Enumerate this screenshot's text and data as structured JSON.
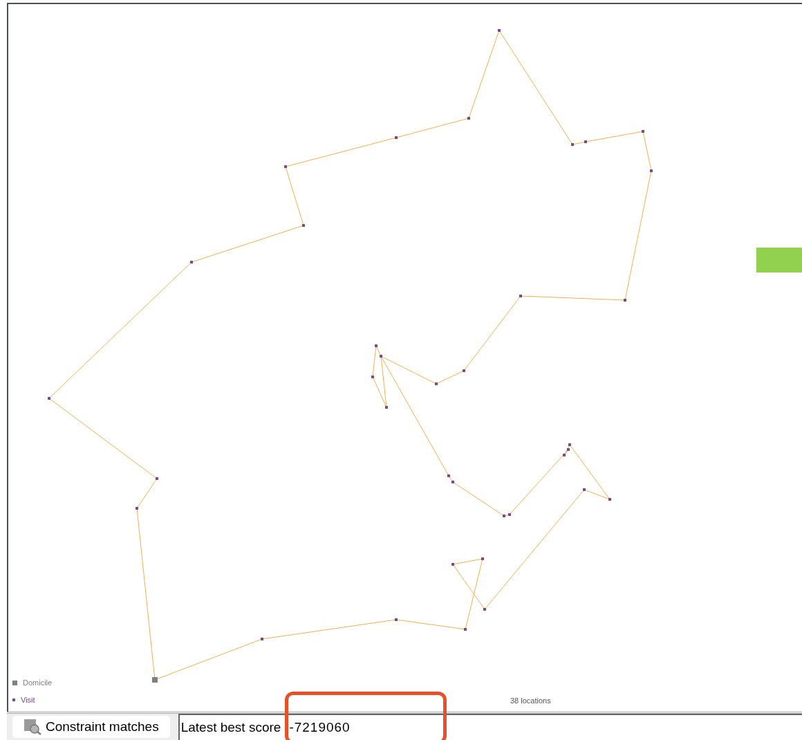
{
  "map": {
    "legend": [
      {
        "label": "Domicile",
        "kind": "domicile",
        "color": "#808080"
      },
      {
        "label": "Visit",
        "kind": "visit",
        "color": "#7a4a8a"
      }
    ],
    "location_count": "38 locations"
  },
  "bottom_bar": {
    "button": "Constraint matches",
    "score_label": "Latest best score",
    "score_value": "-7219060"
  }
}
